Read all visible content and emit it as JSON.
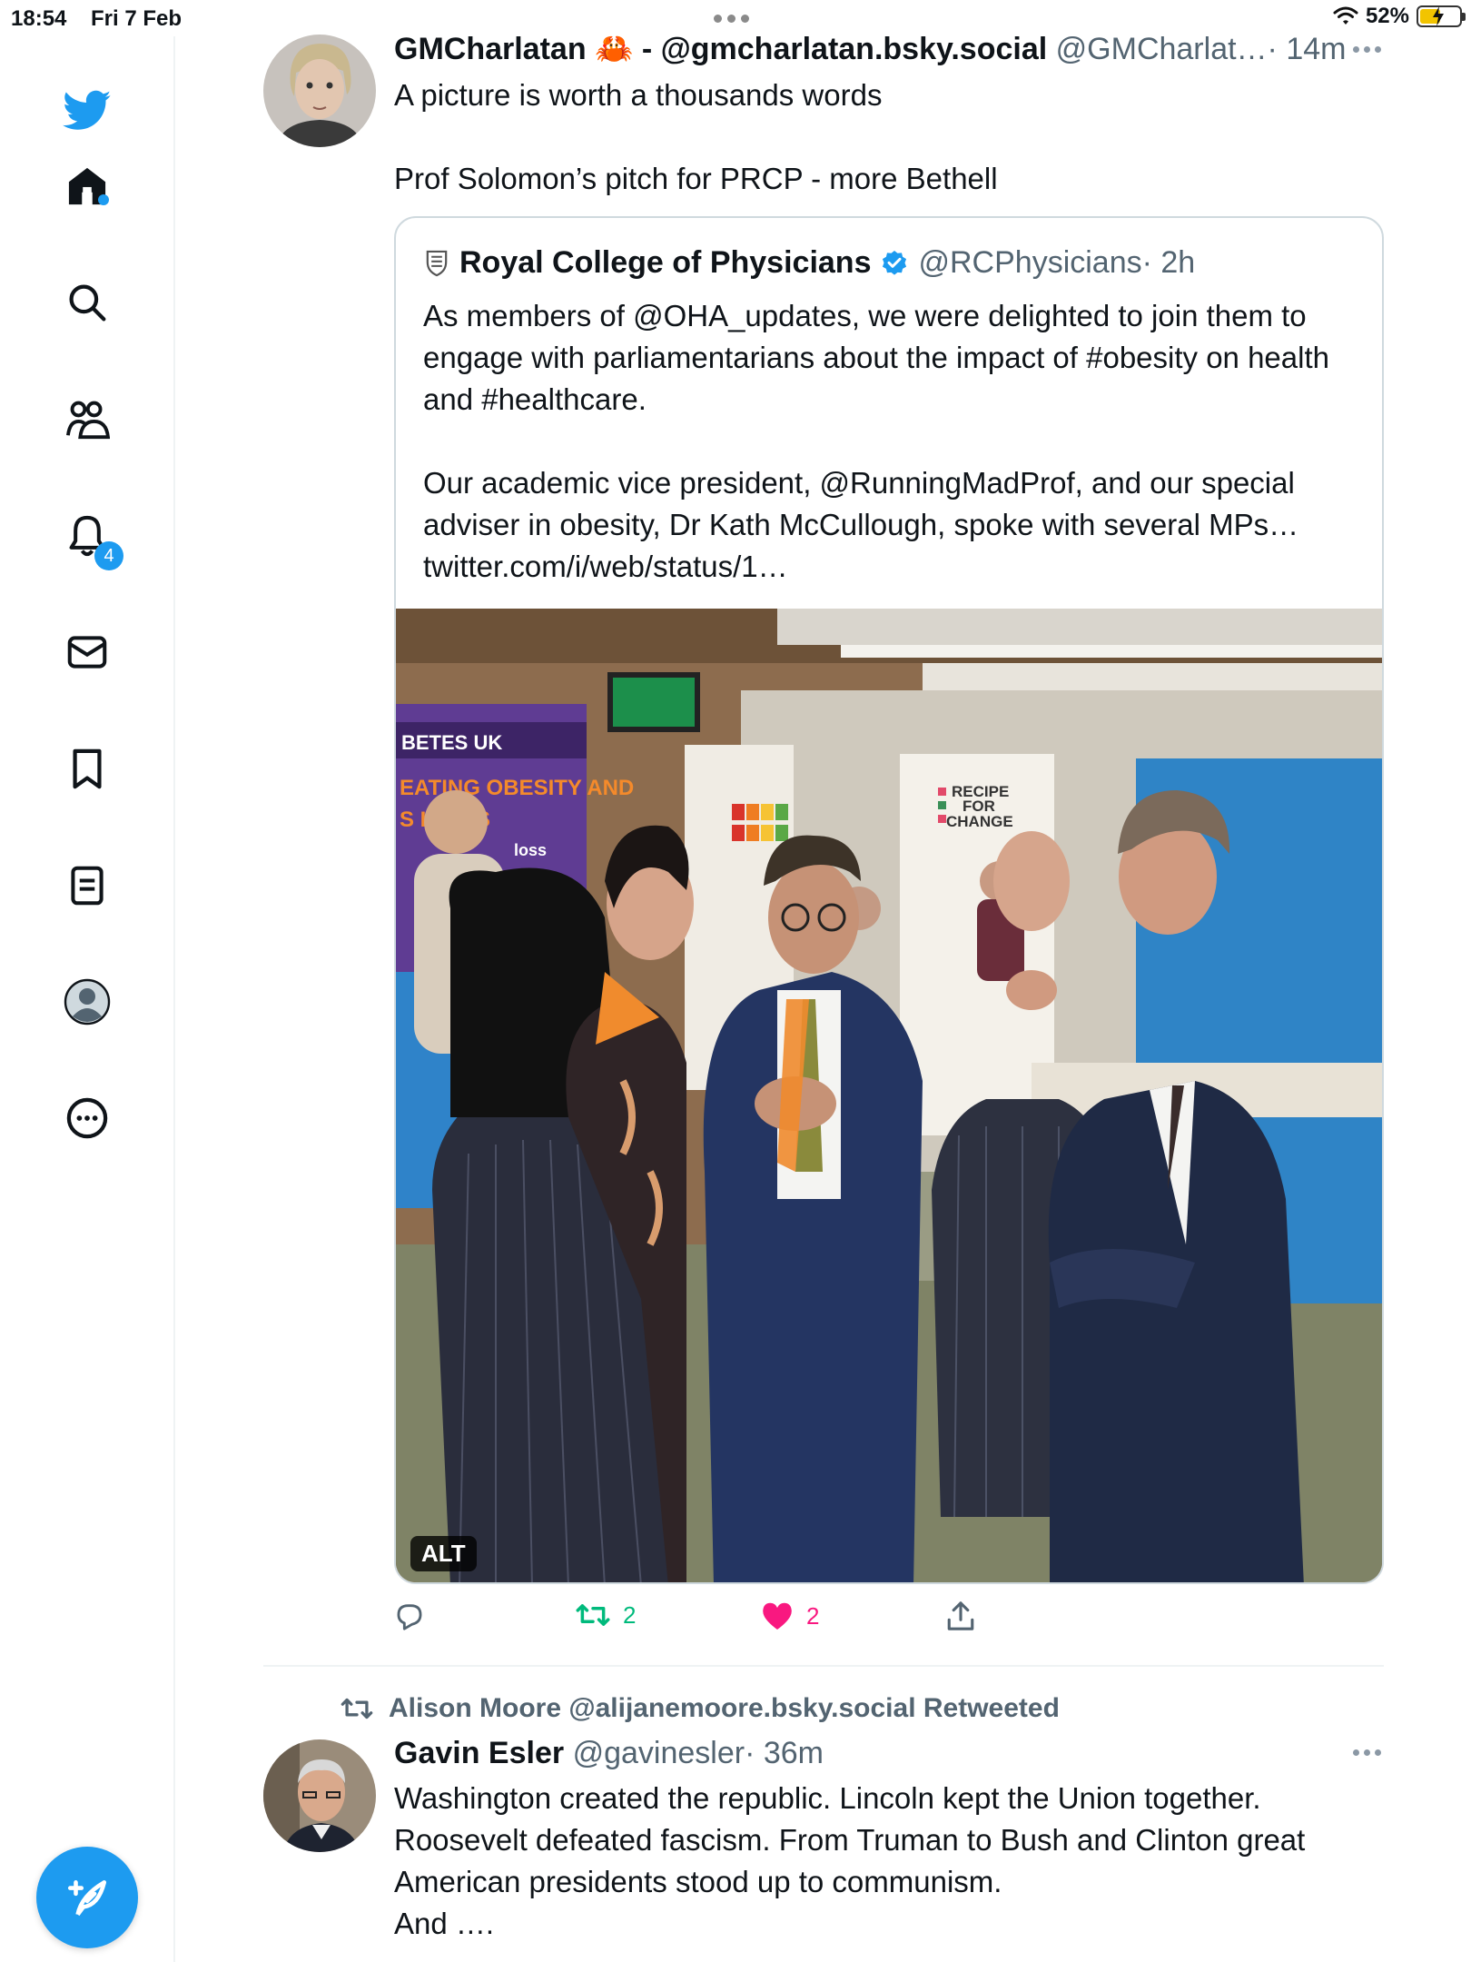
{
  "status_bar": {
    "time": "18:54",
    "date": "Fri 7 Feb",
    "battery": "52%",
    "battery_level": 0.52
  },
  "sidebar": {
    "items": [
      {
        "icon": "twitter-logo-icon"
      },
      {
        "icon": "home-icon"
      },
      {
        "icon": "search-icon"
      },
      {
        "icon": "communities-icon"
      },
      {
        "icon": "notifications-icon",
        "badge": "4"
      },
      {
        "icon": "messages-icon"
      },
      {
        "icon": "bookmarks-icon"
      },
      {
        "icon": "lists-icon"
      },
      {
        "icon": "profile-icon"
      },
      {
        "icon": "more-icon"
      }
    ],
    "compose_icon": "compose-icon"
  },
  "tweet1": {
    "name": "GMCharlatan",
    "name_emoji": "🦀",
    "name_suffix": "- @gmcharlatan.bsky.social",
    "handle": "@GMCharlat…",
    "time": "· 14m",
    "text": "A picture is worth a thousands words\n\nProf Solomon’s pitch for PRCP - more Bethell",
    "quote": {
      "name": "Royal College of Physicians",
      "handle": "@RCPhysicians",
      "time": "· 2h",
      "text": "As members of @OHA_updates, we were delighted to join them to engage with parliamentarians about the impact of #obesity on health and #healthcare.\n\nOur academic vice president, @RunningMadProf, and our special adviser in obesity, Dr Kath McCullough, spoke with several MPs… twitter.com/i/web/status/1…",
      "image_alt_label": "ALT",
      "image_text": {
        "banner_left": "BETES UK",
        "banner_left_2": "EATING OBESITY AND",
        "banner_left_3": "S H        RMS",
        "banner_left_4": "loss",
        "banner_right": "RECIPE\nFOR\nCHANGE"
      }
    },
    "actions": {
      "replies": "",
      "retweets": "2",
      "likes": "2"
    }
  },
  "tweet2": {
    "retweeted_by": "Alison Moore @alijanemoore.bsky.social Retweeted",
    "name": "Gavin Esler",
    "handle": "@gavinesler",
    "time": "· 36m",
    "text": "Washington created the republic. Lincoln  kept the Union together.\nRoosevelt defeated fascism. From Truman to Bush and Clinton great\nAmerican presidents stood up to communism.\nAnd …."
  },
  "colors": {
    "accent": "#1d9bf0",
    "retweet_green": "#00ba7c",
    "like_pink": "#f91880",
    "muted": "#536471"
  }
}
